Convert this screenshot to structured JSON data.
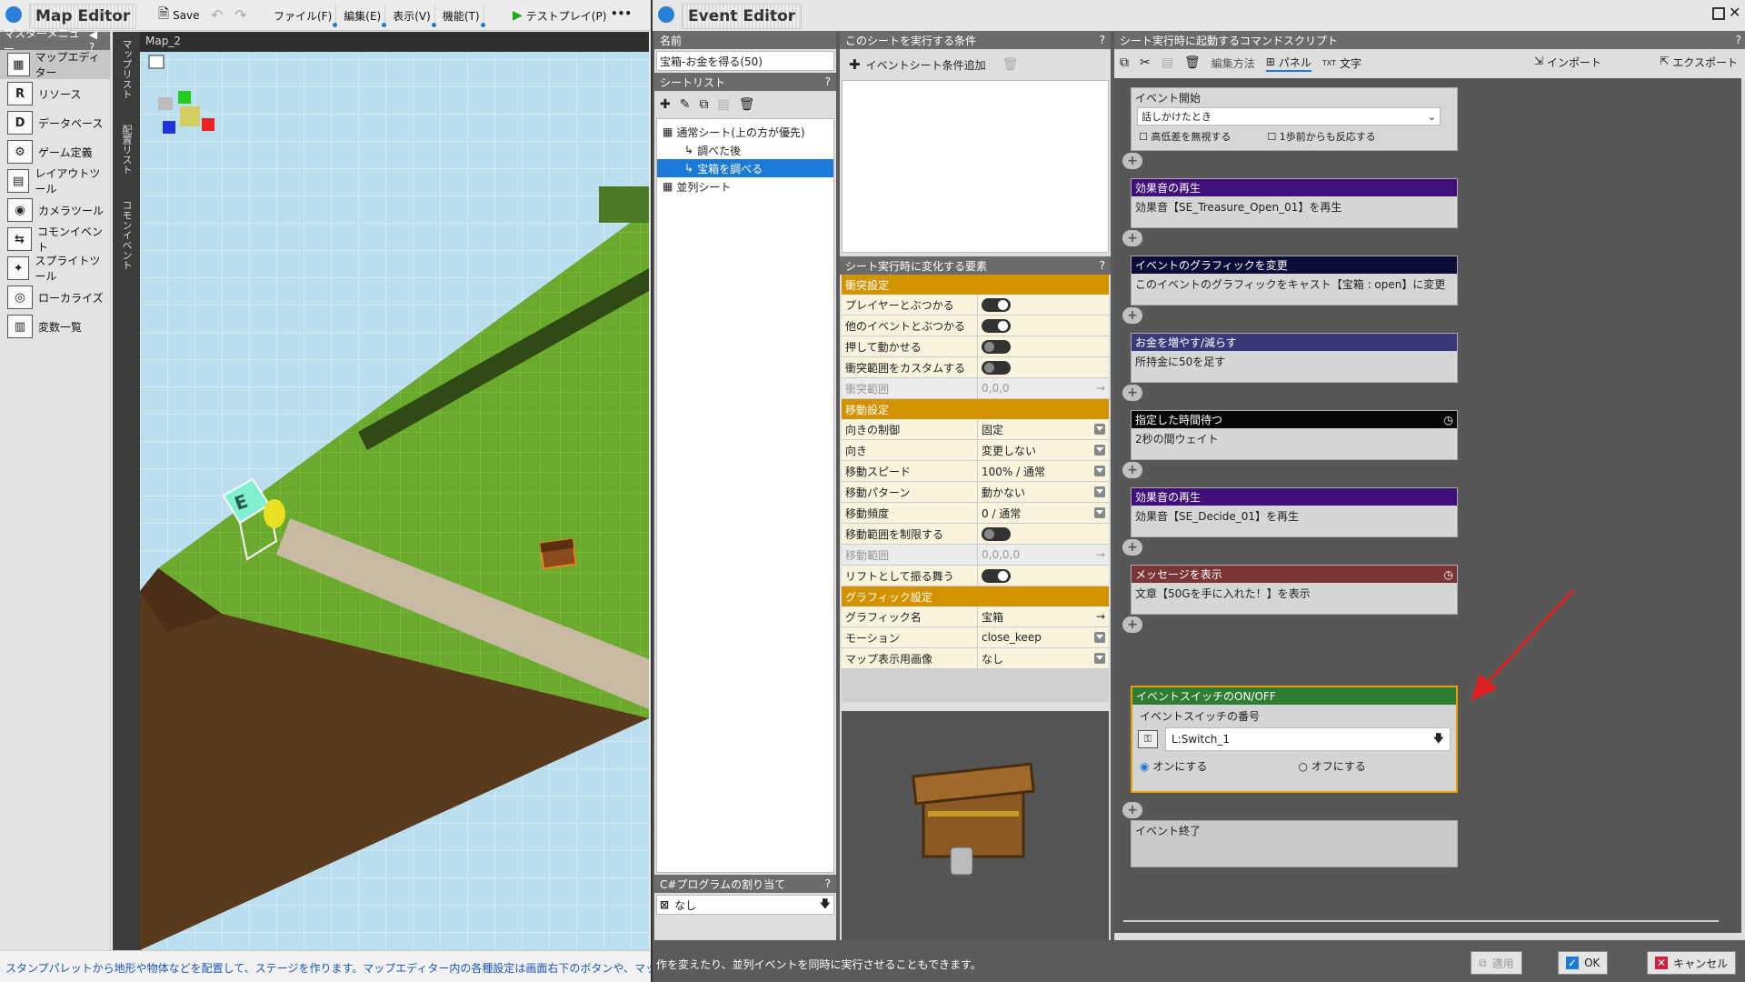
{
  "map_editor": {
    "title": "Map Editor",
    "save_label": "Save",
    "menus": [
      "ファイル(F)",
      "編集(E)",
      "表示(V)",
      "機能(T)"
    ],
    "testplay_label": "テストプレイ(P)",
    "more_label": "•••",
    "master_menu_title": "マスターメニュー",
    "master_items": [
      {
        "label": "マップエディター",
        "icon": "map-editor-icon",
        "glyph": "▦"
      },
      {
        "label": "リソース",
        "icon": "resource-icon",
        "glyph": "R"
      },
      {
        "label": "データベース",
        "icon": "database-icon",
        "glyph": "D"
      },
      {
        "label": "ゲーム定義",
        "icon": "game-definition-icon",
        "glyph": "⚙"
      },
      {
        "label": "レイアウトツール",
        "icon": "layout-tool-icon",
        "glyph": "▤"
      },
      {
        "label": "カメラツール",
        "icon": "camera-tool-icon",
        "glyph": "◉"
      },
      {
        "label": "コモンイベント",
        "icon": "common-event-icon",
        "glyph": "⇆"
      },
      {
        "label": "スプライトツール",
        "icon": "sprite-tool-icon",
        "glyph": "✦"
      },
      {
        "label": "ローカライズ",
        "icon": "localize-icon",
        "glyph": "◎"
      },
      {
        "label": "変数一覧",
        "icon": "variables-icon",
        "glyph": "▥"
      }
    ],
    "vertical_tabs": [
      "マップリスト",
      "配置リスト",
      "コモンイベント"
    ],
    "viewport_tab": "Map_2",
    "status_text": "スタンプパレットから地形や物体などを配置して、ステージを作ります。マップエディター内の各種設定は画面右下のボタンや、マップ設定パレット"
  },
  "event_editor": {
    "title": "Event Editor",
    "name_header": "名前",
    "name_value": "宝箱-お金を得る(50)",
    "sheet_list_header": "シートリスト",
    "sheets": [
      {
        "label": "通常シート(上の方が優先)",
        "indent": 0,
        "selected": false
      },
      {
        "label": "調べた後",
        "indent": 1,
        "selected": false
      },
      {
        "label": "宝箱を調べる",
        "indent": 1,
        "selected": true
      },
      {
        "label": "並列シート",
        "indent": 0,
        "selected": false
      }
    ],
    "csharp_header": "C#プログラムの割り当て",
    "csharp_value": "なし",
    "condition_header": "このシートを実行する条件",
    "add_condition_label": "イベントシート条件追加",
    "elements_header": "シート実行時に変化する要素",
    "properties": [
      {
        "type": "category",
        "label": "衝突設定"
      },
      {
        "type": "toggle",
        "label": "プレイヤーとぶつかる",
        "on": true
      },
      {
        "type": "toggle",
        "label": "他のイベントとぶつかる",
        "on": true
      },
      {
        "type": "toggle",
        "label": "押して動かせる",
        "on": false
      },
      {
        "type": "toggle",
        "label": "衝突範囲をカスタムする",
        "on": false
      },
      {
        "type": "disabled",
        "label": "衝突範囲",
        "value": "0,0,0"
      },
      {
        "type": "category",
        "label": "移動設定"
      },
      {
        "type": "select",
        "label": "向きの制御",
        "value": "固定"
      },
      {
        "type": "select",
        "label": "向き",
        "value": "変更しない"
      },
      {
        "type": "select",
        "label": "移動スピード",
        "value": "100% / 通常"
      },
      {
        "type": "select",
        "label": "移動パターン",
        "value": "動かない"
      },
      {
        "type": "select",
        "label": "移動頻度",
        "value": "0 / 通常"
      },
      {
        "type": "toggle",
        "label": "移動範囲を制限する",
        "on": false
      },
      {
        "type": "disabled",
        "label": "移動範囲",
        "value": "0,0,0,0"
      },
      {
        "type": "toggle",
        "label": "リフトとして振る舞う",
        "on": true
      },
      {
        "type": "category",
        "label": "グラフィック設定"
      },
      {
        "type": "link",
        "label": "グラフィック名",
        "value": "宝箱"
      },
      {
        "type": "select",
        "label": "モーション",
        "value": "close_keep"
      },
      {
        "type": "select",
        "label": "マップ表示用画像",
        "value": "なし"
      }
    ],
    "script_header": "シート実行時に起動するコマンドスクリプト",
    "toolbar": {
      "edit_method": "編集方法",
      "panel": "パネル",
      "text": "文字",
      "import": "インポート",
      "export": "エクスポート"
    },
    "event_start": {
      "label": "イベント開始",
      "trigger": "話しかけたとき",
      "ignore_height": "高低差を無視する",
      "one_step": "1歩前からも反応する"
    },
    "commands": [
      {
        "title": "効果音の再生",
        "body": "効果音【SE_Treasure_Open_01】を再生",
        "color": "#3f0f7a",
        "clock": false
      },
      {
        "title": "イベントのグラフィックを変更",
        "body": "このイベントのグラフィックをキャスト【宝箱 : open】に変更",
        "color": "#0c0c38",
        "clock": false
      },
      {
        "title": "お金を増やす/減らす",
        "body": "所持金に50を足す",
        "color": "#3a3a7a",
        "clock": false
      },
      {
        "title": "指定した時間待つ",
        "body": "2秒の間ウェイト",
        "color": "#070707",
        "clock": true
      },
      {
        "title": "効果音の再生",
        "body": "効果音【SE_Decide_01】を再生",
        "color": "#3f0f7a",
        "clock": false
      },
      {
        "title": "メッセージを表示",
        "body": "文章【50Gを手に入れた！】を表示",
        "color": "#7a3535",
        "clock": true
      }
    ],
    "switch_cmd": {
      "title": "イベントスイッチのON/OFF",
      "label": "イベントスイッチの番号",
      "value": "L:Switch_1",
      "on_label": "オンにする",
      "off_label": "オフにする",
      "color": "#2e7d32"
    },
    "event_end": "イベント終了",
    "status_text": "作を変えたり、並列イベントを同時に実行させることもできます。",
    "buttons": {
      "apply": "適用",
      "ok": "OK",
      "cancel": "キャンセル"
    }
  },
  "colors": {
    "accent_blue": "#1a7ad8",
    "highlight_orange": "#e8a000",
    "annotation_arrow": "#e02020"
  }
}
